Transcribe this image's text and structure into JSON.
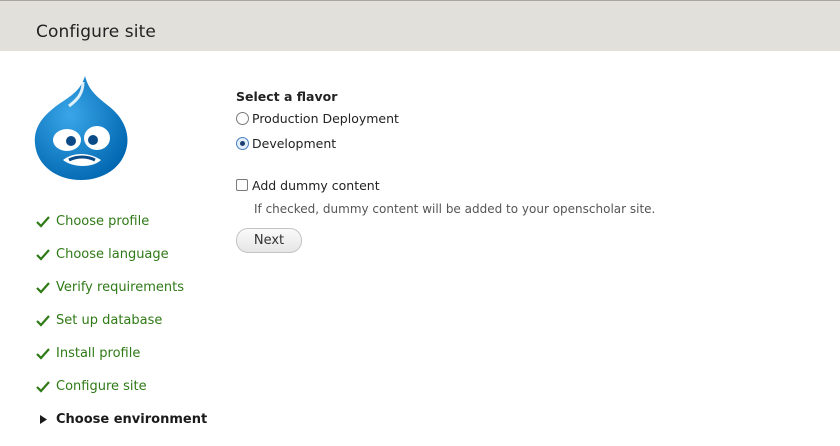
{
  "header": {
    "title": "Configure site"
  },
  "logo": {
    "icon": "drupal-drop-logo",
    "color": "#0077c0"
  },
  "steps": [
    {
      "label": "Choose profile",
      "status": "done"
    },
    {
      "label": "Choose language",
      "status": "done"
    },
    {
      "label": "Verify requirements",
      "status": "done"
    },
    {
      "label": "Set up database",
      "status": "done"
    },
    {
      "label": "Install profile",
      "status": "done"
    },
    {
      "label": "Configure site",
      "status": "done"
    },
    {
      "label": "Choose environment",
      "status": "active"
    }
  ],
  "form": {
    "flavor_label": "Select a flavor",
    "flavor_options": [
      {
        "label": "Production Deployment",
        "selected": false
      },
      {
        "label": "Development",
        "selected": true
      }
    ],
    "dummy_content": {
      "label": "Add dummy content",
      "checked": false,
      "description": "If checked, dummy content will be added to your openscholar site."
    },
    "next_label": "Next"
  },
  "colors": {
    "header_bg": "#e2e0da",
    "done_step": "#2f7a16",
    "active_step": "#1a1a1a"
  }
}
